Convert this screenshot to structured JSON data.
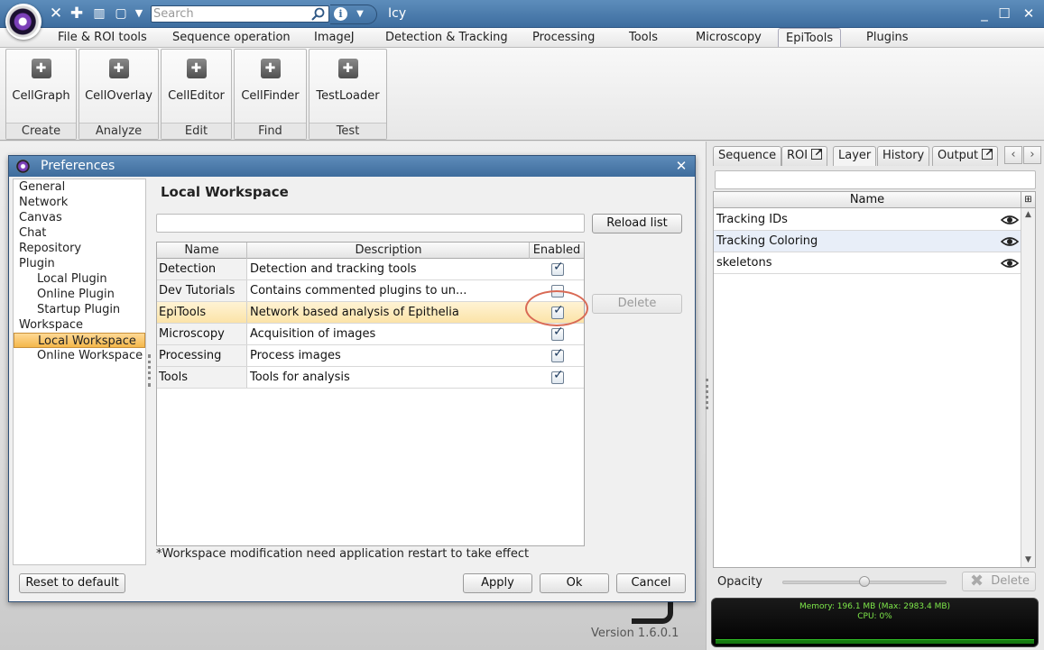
{
  "app": {
    "title": "Icy",
    "search_placeholder": "Search",
    "version": "Version 1.6.0.1"
  },
  "ribbon": {
    "tabs": [
      "File & ROI tools",
      "Sequence operation",
      "ImageJ",
      "Detection & Tracking",
      "Processing",
      "Tools",
      "Microscopy",
      "EpiTools",
      "Plugins"
    ],
    "active_tab": "EpiTools",
    "groups": [
      {
        "button": "CellGraph",
        "group": "Create"
      },
      {
        "button": "CellOverlay",
        "group": "Analyze"
      },
      {
        "button": "CellEditor",
        "group": "Edit"
      },
      {
        "button": "CellFinder",
        "group": "Find"
      },
      {
        "button": "TestLoader",
        "group": "Test"
      }
    ]
  },
  "preferences": {
    "title": "Preferences",
    "tree": [
      {
        "label": "General",
        "level": 0
      },
      {
        "label": "Network",
        "level": 0
      },
      {
        "label": "Canvas",
        "level": 0
      },
      {
        "label": "Chat",
        "level": 0
      },
      {
        "label": "Repository",
        "level": 0
      },
      {
        "label": "Plugin",
        "level": 0
      },
      {
        "label": "Local Plugin",
        "level": 1
      },
      {
        "label": "Online Plugin",
        "level": 1
      },
      {
        "label": "Startup Plugin",
        "level": 1
      },
      {
        "label": "Workspace",
        "level": 0
      },
      {
        "label": "Local Workspace",
        "level": 1,
        "selected": true
      },
      {
        "label": "Online Workspace",
        "level": 1
      }
    ],
    "heading": "Local Workspace",
    "filter_value": "",
    "reload_label": "Reload list",
    "delete_label": "Delete",
    "columns": [
      "Name",
      "Description",
      "Enabled"
    ],
    "rows": [
      {
        "name": "Detection",
        "description": "Detection and tracking tools",
        "enabled": true
      },
      {
        "name": "Dev Tutorials",
        "description": "Contains commented plugins to un...",
        "enabled": false
      },
      {
        "name": "EpiTools",
        "description": "Network based analysis of Epithelia",
        "enabled": true,
        "highlighted": true
      },
      {
        "name": "Microscopy",
        "description": "Acquisition of images",
        "enabled": true
      },
      {
        "name": "Processing",
        "description": "Process images",
        "enabled": true
      },
      {
        "name": "Tools",
        "description": "Tools for analysis",
        "enabled": true
      }
    ],
    "note": "*Workspace modification need application restart to take effect",
    "buttons": {
      "reset": "Reset to default",
      "apply": "Apply",
      "ok": "Ok",
      "cancel": "Cancel"
    }
  },
  "right_panel": {
    "tabs": [
      "Sequence",
      "ROI",
      "Layer",
      "History",
      "Output"
    ],
    "active_tab": "Layer",
    "column": "Name",
    "layers": [
      {
        "name": "Tracking IDs",
        "visible": true
      },
      {
        "name": "Tracking Coloring",
        "visible": true,
        "selected": true
      },
      {
        "name": "skeletons",
        "visible": true
      }
    ],
    "opacity_label": "Opacity",
    "opacity_value": 0.5,
    "delete_label": "Delete"
  },
  "memory": {
    "line1": "Memory: 196.1 MB  (Max: 2983.4 MB)",
    "line2": "CPU: 0%"
  },
  "colors": {
    "title_bar": "#4a7aab",
    "selection": "#f4b74a",
    "annotation_circle": "#d96a55",
    "memory_text": "#7ee84a"
  }
}
